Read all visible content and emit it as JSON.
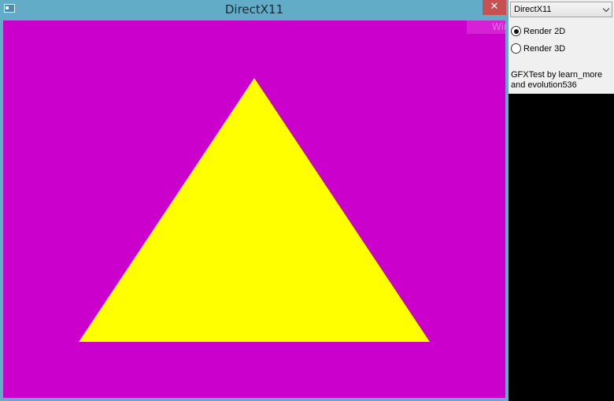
{
  "window": {
    "title": "DirectX11",
    "close_label": "✕",
    "overlay_text": "Win",
    "icons": {
      "app": "app-window-icon",
      "close": "close-icon"
    }
  },
  "scene": {
    "background_color": "#cc00cc",
    "triangle_color": "#ffff00"
  },
  "panel": {
    "renderer_select": {
      "value": "DirectX11",
      "chevron_icon": "chevron-down-icon"
    },
    "render_modes": [
      {
        "label": "Render 2D",
        "checked": true
      },
      {
        "label": "Render 3D",
        "checked": false
      }
    ],
    "credits": [
      "GFXTest by learn_more",
      "and evolution536"
    ]
  },
  "colors": {
    "titlebar": "#63acc8",
    "close_button": "#c75050",
    "panel_bg": "#f0f0f0",
    "backdrop": "#000000"
  }
}
